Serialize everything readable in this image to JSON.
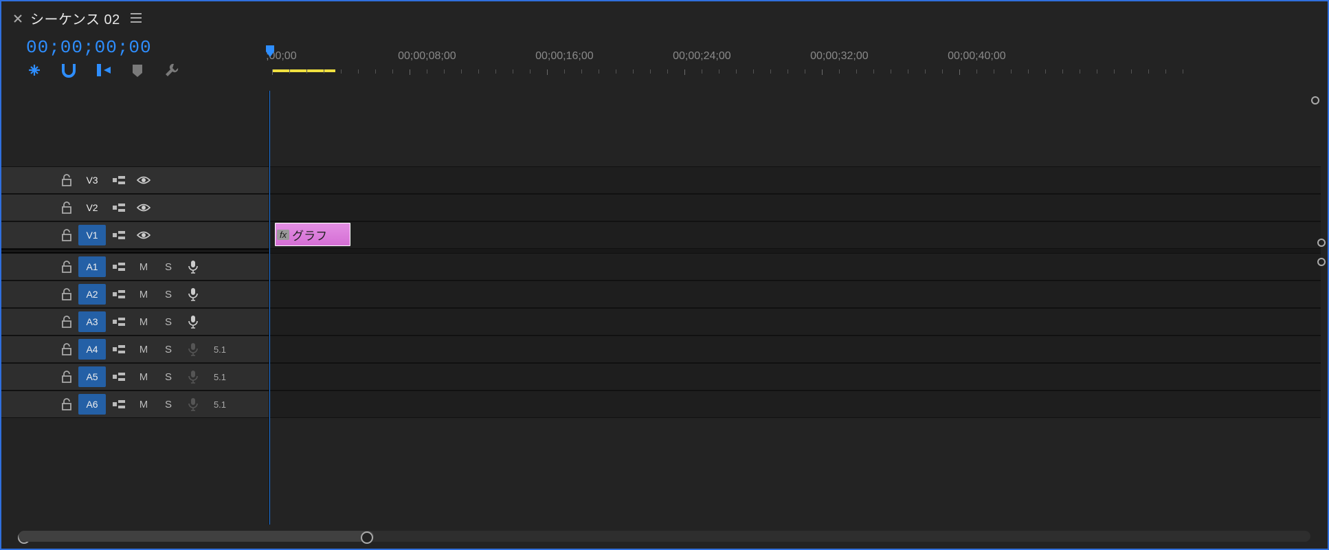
{
  "tab": {
    "title": "シーケンス 02"
  },
  "timecode": "00;00;00;00",
  "ruler": {
    "labels": [
      ";00;00",
      "00;00;08;00",
      "00;00;16;00",
      "00;00;24;00",
      "00;00;32;00",
      "00;00;40;00"
    ]
  },
  "videoTracks": [
    {
      "label": "V3",
      "selected": false
    },
    {
      "label": "V2",
      "selected": false
    },
    {
      "label": "V1",
      "selected": true
    }
  ],
  "audioTracks": [
    {
      "label": "A1",
      "selected": true,
      "mute": "M",
      "solo": "S",
      "variant": ""
    },
    {
      "label": "A2",
      "selected": true,
      "mute": "M",
      "solo": "S",
      "variant": ""
    },
    {
      "label": "A3",
      "selected": true,
      "mute": "M",
      "solo": "S",
      "variant": ""
    },
    {
      "label": "A4",
      "selected": true,
      "mute": "M",
      "solo": "S",
      "variant": "5.1"
    },
    {
      "label": "A5",
      "selected": true,
      "mute": "M",
      "solo": "S",
      "variant": "5.1"
    },
    {
      "label": "A6",
      "selected": true,
      "mute": "M",
      "solo": "S",
      "variant": "5.1"
    }
  ],
  "clip": {
    "fx": "fx",
    "name": "グラフ"
  },
  "colors": {
    "accent": "#2e8eff",
    "clip": "#e38fe3"
  }
}
